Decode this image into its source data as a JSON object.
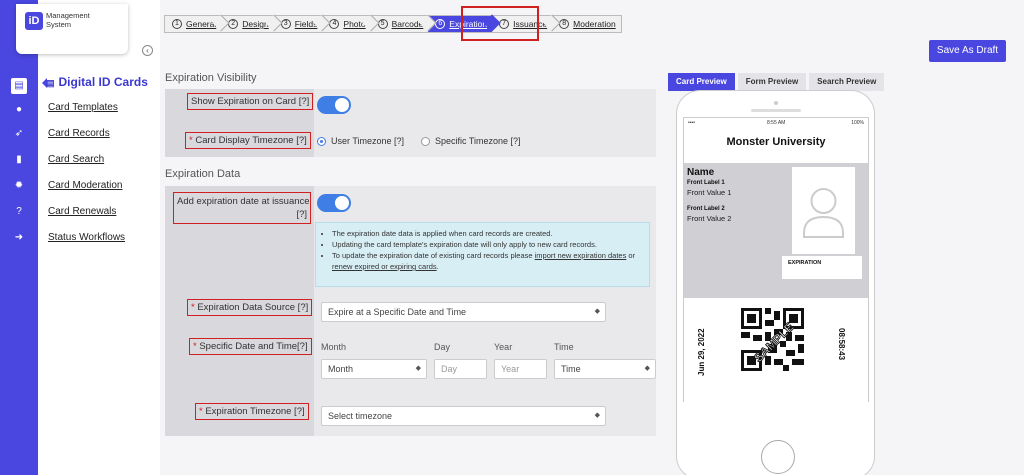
{
  "brand": {
    "logo": "iD",
    "name": "Management System"
  },
  "rail": {
    "icons": [
      "card-icon",
      "chat-icon",
      "rocket-icon",
      "document-icon",
      "gear-icon",
      "help-icon",
      "logout-icon"
    ]
  },
  "sidebar": {
    "title": "Digital ID Cards",
    "items": [
      "Card Templates",
      "Card Records",
      "Card Search",
      "Card Moderation",
      "Card Renewals",
      "Status Workflows"
    ]
  },
  "wizard": {
    "steps": [
      {
        "num": "1",
        "label": "General"
      },
      {
        "num": "2",
        "label": "Design"
      },
      {
        "num": "3",
        "label": "Fields"
      },
      {
        "num": "4",
        "label": "Photo"
      },
      {
        "num": "5",
        "label": "Barcode"
      },
      {
        "num": "6",
        "label": "Expiration"
      },
      {
        "num": "7",
        "label": "Issuance"
      },
      {
        "num": "8",
        "label": "Moderation"
      }
    ],
    "active": "Expiration"
  },
  "actions": {
    "save_draft": "Save As Draft"
  },
  "visibility": {
    "section": "Expiration Visibility",
    "show_label": "Show Expiration on Card [?]",
    "show_enabled": true,
    "timezone_label": "Card Display Timezone [?]",
    "timezone_options": [
      "User Timezone [?]",
      "Specific Timezone [?]"
    ],
    "timezone_selected": "User Timezone [?]"
  },
  "data": {
    "section": "Expiration Data",
    "add_label_1": "Add expiration date at issuance",
    "add_label_2": "[?]",
    "add_enabled": true,
    "info": {
      "line1": "The expiration date data is applied when card records are created.",
      "line2": "Updating the card template's expiration date will only apply to new card records.",
      "line3_pre": "To update the expiration date of existing card records please ",
      "link1": "import new expiration dates",
      "line3_mid": " or ",
      "link2": "renew expired or expiring cards",
      "line3_end": "."
    },
    "source_label": "Expiration Data Source [?]",
    "source_value": "Expire at a Specific Date and Time",
    "specific_label": "Specific Date and Time[?]",
    "col_month": "Month",
    "col_day": "Day",
    "col_year": "Year",
    "col_time": "Time",
    "month_value": "Month",
    "day_placeholder": "Day",
    "year_placeholder": "Year",
    "time_value": "Time",
    "tz_label": "Expiration Timezone [?]",
    "tz_placeholder": "Select timezone"
  },
  "preview": {
    "tabs": [
      "Card Preview",
      "Form Preview",
      "Search Preview"
    ],
    "active_tab": "Card Preview",
    "status_time": "8:55 AM",
    "status_battery": "100%",
    "status_signal": "•••• ",
    "university": "Monster University",
    "name": "Name",
    "front_label_1": "Front Label 1",
    "front_value_1": "Front Value 1",
    "front_label_2": "Front Label 2",
    "front_value_2": "Front Value 2",
    "expiration": "EXPIRATION",
    "date": "Jun 29, 2022",
    "time": "08:58:43",
    "sample": "SAMPLE"
  }
}
